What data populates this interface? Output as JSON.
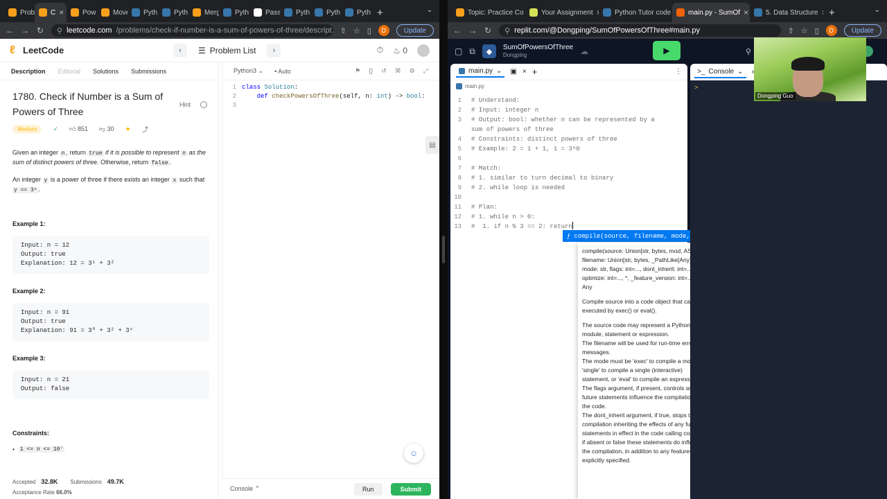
{
  "left_window": {
    "tabs": [
      {
        "label": "Prob",
        "color": "#f89f1b"
      },
      {
        "label": "C",
        "color": "#f89f1b",
        "active": true
      },
      {
        "label": "Pow",
        "color": "#f89f1b"
      },
      {
        "label": "Move",
        "color": "#f89f1b"
      },
      {
        "label": "Pyth",
        "color": "#3776ab"
      },
      {
        "label": "Pyth",
        "color": "#3776ab"
      },
      {
        "label": "Merg",
        "color": "#f89f1b"
      },
      {
        "label": "Pyth",
        "color": "#3776ab"
      },
      {
        "label": "Pass",
        "color": "#ffffff"
      },
      {
        "label": "Pyth",
        "color": "#3776ab"
      },
      {
        "label": "Pyth",
        "color": "#3776ab"
      },
      {
        "label": "Pyth",
        "color": "#3776ab"
      }
    ],
    "url_host": "leetcode.com",
    "url_path": "/problems/check-if-number-is-a-sum-of-powers-of-three/descript...",
    "profile_letter": "D",
    "update_label": "Update"
  },
  "leetcode": {
    "logo_text": "LeetCode",
    "problem_list_label": "Problem List",
    "streak_count": "0",
    "desc_tabs": [
      {
        "label": "Description",
        "state": "on"
      },
      {
        "label": "Editorial",
        "state": "off"
      },
      {
        "label": "Solutions",
        "state": "normal"
      },
      {
        "label": "Submissions",
        "state": "normal"
      }
    ],
    "title": "1780. Check if Number is a Sum of Powers of Three",
    "hint_label": "Hint",
    "difficulty": "Medium",
    "likes": "851",
    "dislikes": "30",
    "para1_a": "Given an integer ",
    "para1_code1": "n",
    "para1_b": ", return ",
    "para1_code2": "true",
    "para1_c": " if it is possible to represent ",
    "para1_code3": "n",
    "para1_d": " as the sum of distinct powers of three.",
    "para1_e": " Otherwise, return ",
    "para1_code4": "false",
    "para1_f": ".",
    "para2_a": "An integer ",
    "para2_code1": "y",
    "para2_b": " is a power of three if there exists an integer ",
    "para2_code2": "x",
    "para2_c": " such that ",
    "para2_code3": "y == 3ˣ",
    "para2_d": ".",
    "examples": [
      {
        "heading": "Example 1:",
        "body": "Input: n = 12\nOutput: true\nExplanation: 12 = 3¹ + 3²"
      },
      {
        "heading": "Example 2:",
        "body": "Input: n = 91\nOutput: true\nExplanation: 91 = 3⁰ + 3² + 3⁴"
      },
      {
        "heading": "Example 3:",
        "body": "Input: n = 21\nOutput: false"
      }
    ],
    "constraints_heading": "Constraints:",
    "constraint_1": "1 <= n <= 10⁷",
    "accepted_label": "Accepted",
    "accepted_value": "32.8K",
    "submissions_label": "Submissions",
    "submissions_value": "49.7K",
    "acceptance_label": "Acceptance Rate",
    "acceptance_value": "66.0%",
    "editor_lang": "Python3",
    "editor_mode": "Auto",
    "code_lines": [
      {
        "n": "1",
        "parts": [
          [
            "kw",
            "class "
          ],
          [
            "ty",
            "Solution"
          ],
          [
            "",
            ""
          ],
          [
            "",
            ":"
          ]
        ]
      },
      {
        "n": "2",
        "parts": [
          [
            "",
            "    "
          ],
          [
            "kw",
            "def "
          ],
          [
            "fn",
            "checkPowersOfThree"
          ],
          [
            "",
            "(self, n: "
          ],
          [
            "ty",
            "int"
          ],
          [
            "",
            ") -> "
          ],
          [
            "ty",
            "bool"
          ],
          [
            "",
            ":"
          ]
        ]
      },
      {
        "n": "3",
        "parts": [
          [
            "",
            ""
          ]
        ]
      }
    ],
    "console_label": "Console",
    "run_label": "Run",
    "submit_label": "Submit"
  },
  "right_window": {
    "tabs": [
      {
        "label": "Topic: Practice Co",
        "color": "#f89f1b"
      },
      {
        "label": "Your Assignment",
        "color": "#d4e157"
      },
      {
        "label": "Python Tutor code",
        "color": "#3776ab"
      },
      {
        "label": "main.py - SumOf",
        "color": "#f26207",
        "active": true
      },
      {
        "label": "5. Data Structure",
        "color": "#3776ab"
      }
    ],
    "url": "replit.com/@Dongping/SumOfPowersOfThree#main.py",
    "profile_letter": "D",
    "update_label": "Update"
  },
  "replit": {
    "repl_name": "SumOfPowersOfThree",
    "owner": "Dongping",
    "file_tab": "main.py",
    "breadcrumb": "main.py",
    "console_tab": "Console",
    "console_prompt": ">",
    "video_name": "Dongping Guo",
    "lines": [
      {
        "n": "1",
        "text": "# Understand:"
      },
      {
        "n": "2",
        "text": "# Input: integer n"
      },
      {
        "n": "3",
        "text": "# Output: bool: whether n can be represented by a"
      },
      {
        "n": "",
        "text": "sum of powers of three"
      },
      {
        "n": "4",
        "text": "# Constraints: distinct powers of three"
      },
      {
        "n": "5",
        "text": "# Example: 2 = 1 + 1, 1 = 3^0"
      },
      {
        "n": "6",
        "text": ""
      },
      {
        "n": "7",
        "text": "# Match:"
      },
      {
        "n": "8",
        "text": "# 1. similar to turn decimal to binary"
      },
      {
        "n": "9",
        "text": "# 2. while loop is needed"
      },
      {
        "n": "10",
        "text": ""
      },
      {
        "n": "11",
        "text": "# Plan:"
      },
      {
        "n": "12",
        "text": "# 1. while n > 0:"
      },
      {
        "n": "13",
        "text": "#  1. if n % 3 == 2: return"
      }
    ],
    "autocomplete": "compile(source, filename, mode, flags, dont_inherit, opt…",
    "doc_signature": "compile(source: Union[str, bytes, mod, AST], filename: Union[str, bytes, _PathLike[Any]], mode: str, flags: int=..., dont_inherit: int=..., optimize: int=..., *, _feature_version: int=...) -> Any",
    "doc_summary": "Compile source into a code object that can be executed by exec() or eval().",
    "doc_body": "The source code may represent a Python module, statement or expression.\nThe filename will be used for run-time error messages.\nThe mode must be 'exec' to compile a module, 'single' to compile a single (interactive) statement, or 'eval' to compile an expression.\nThe flags argument, if present, controls which future statements influence the compilation of the code.\nThe dont_inherit argument, if true, stops the compilation inheriting the effects of any future statements in effect in the code calling compile; if absent or false these statements do influence the compilation, in addition to any features explicitly specified."
  }
}
